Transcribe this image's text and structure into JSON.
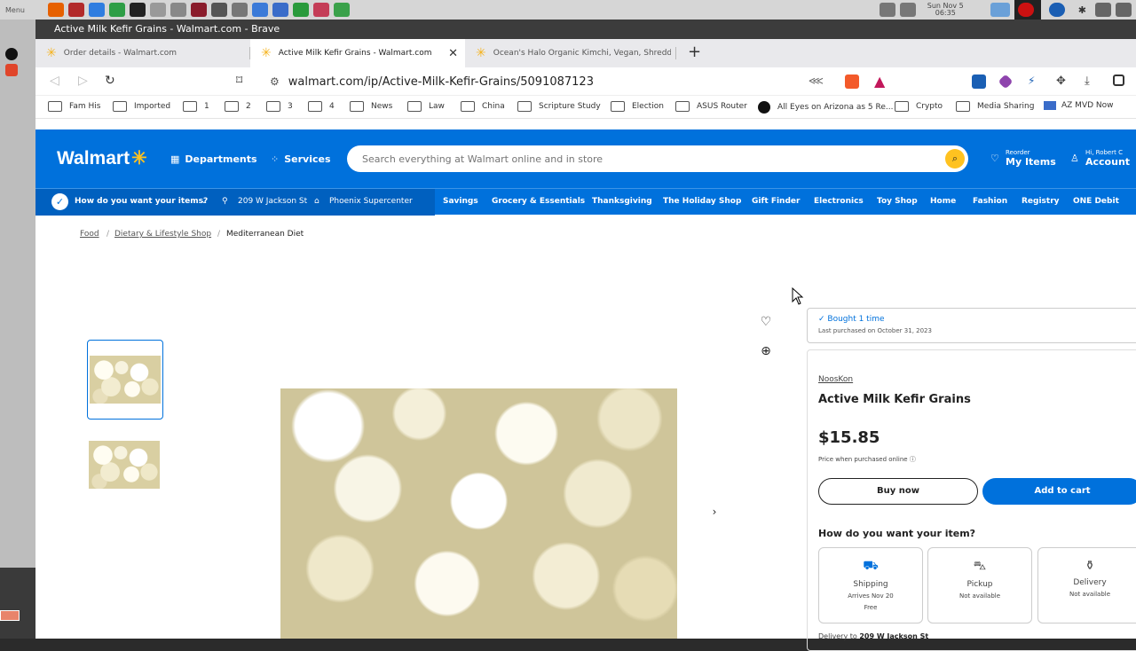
{
  "taskbar": {
    "menu_label": "Menu",
    "clock_line1": "Sun Nov 5",
    "clock_line2": "06:35"
  },
  "window": {
    "title": "Active Milk Kefir Grains - Walmart.com - Brave"
  },
  "tabs": [
    {
      "label": "Order details - Walmart.com",
      "active": false
    },
    {
      "label": "Active Milk Kefir Grains - Walmart.com",
      "active": true
    },
    {
      "label": "Ocean's Halo Organic Kimchi, Vegan, Shredded, Sh...",
      "active": false
    }
  ],
  "address": {
    "url": "walmart.com/ip/Active-Milk-Kefir-Grains/5091087123"
  },
  "bookmarks": [
    "Fam His",
    "Imported",
    "1",
    "2",
    "3",
    "4",
    "News",
    "Law",
    "China",
    "Scripture Study",
    "Election",
    "ASUS Router",
    "All Eyes on Arizona as 5 Re...",
    "Crypto",
    "Media Sharing",
    "AZ MVD Now"
  ],
  "walmart": {
    "logo": "Walmart",
    "departments": "Departments",
    "services": "Services",
    "search_placeholder": "Search everything at Walmart online and in store",
    "reorder_small": "Reorder",
    "reorder_big": "My Items",
    "account_small": "Hi, Robert C",
    "account_big": "Account"
  },
  "subnav": {
    "how": "How do you want your items?",
    "address": "209 W Jackson St",
    "store": "Phoenix Supercenter",
    "links": [
      "Savings",
      "Grocery & Essentials",
      "Thanksgiving",
      "The Holiday Shop",
      "Gift Finder",
      "Electronics",
      "Toy Shop",
      "Home",
      "Fashion",
      "Registry",
      "ONE Debit"
    ]
  },
  "breadcrumb": [
    "Food",
    "Dietary & Lifestyle Shop",
    "Mediterranean Diet"
  ],
  "product": {
    "bought": "Bought 1 time",
    "last_purchased": "Last purchased on October 31, 2023",
    "brand": "NoosKon",
    "title": "Active Milk Kefir Grains",
    "price": "$15.85",
    "price_note": "Price when purchased online",
    "buy_now": "Buy now",
    "add_to_cart": "Add to cart",
    "how_question": "How do you want your item?",
    "fulfillment": [
      {
        "label": "Shipping",
        "line1": "Arrives Nov 20",
        "line2": "Free",
        "icon": "truck-icon"
      },
      {
        "label": "Pickup",
        "line1": "Not available",
        "line2": "",
        "icon": "car-icon"
      },
      {
        "label": "Delivery",
        "line1": "Not available",
        "line2": "",
        "icon": "bag-icon"
      }
    ],
    "delivery_to_label": "Delivery to",
    "delivery_to_address": "209 W Jackson St"
  },
  "colors": {
    "walmart_blue": "#0071dc",
    "spark_yellow": "#ffc220"
  }
}
